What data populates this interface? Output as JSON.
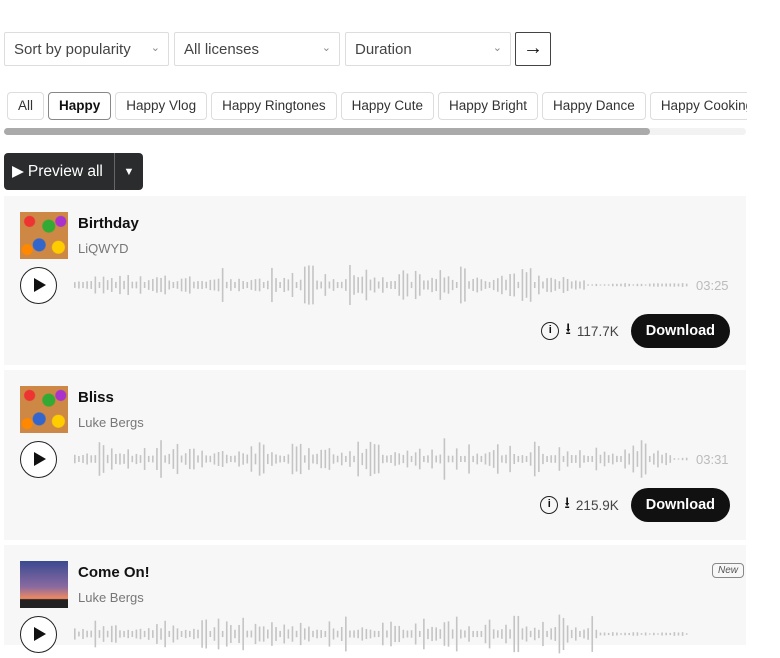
{
  "filters": {
    "sort": "Sort by popularity",
    "license": "All licenses",
    "duration": "Duration",
    "go_icon": "arrow-right"
  },
  "tags": [
    "All",
    "Happy",
    "Happy Vlog",
    "Happy Ringtones",
    "Happy Cute",
    "Happy Bright",
    "Happy Dance",
    "Happy Cooking"
  ],
  "active_tag": "Happy",
  "preview": {
    "label": "Preview all"
  },
  "tracks": [
    {
      "title": "Birthday",
      "artist": "LiQWYD",
      "duration": "03:25",
      "downloads": "117.7K",
      "download_label": "Download"
    },
    {
      "title": "Bliss",
      "artist": "Luke Bergs",
      "duration": "03:31",
      "downloads": "215.9K",
      "download_label": "Download"
    },
    {
      "title": "Come On!",
      "artist": "Luke Bergs",
      "badge": "New"
    }
  ]
}
